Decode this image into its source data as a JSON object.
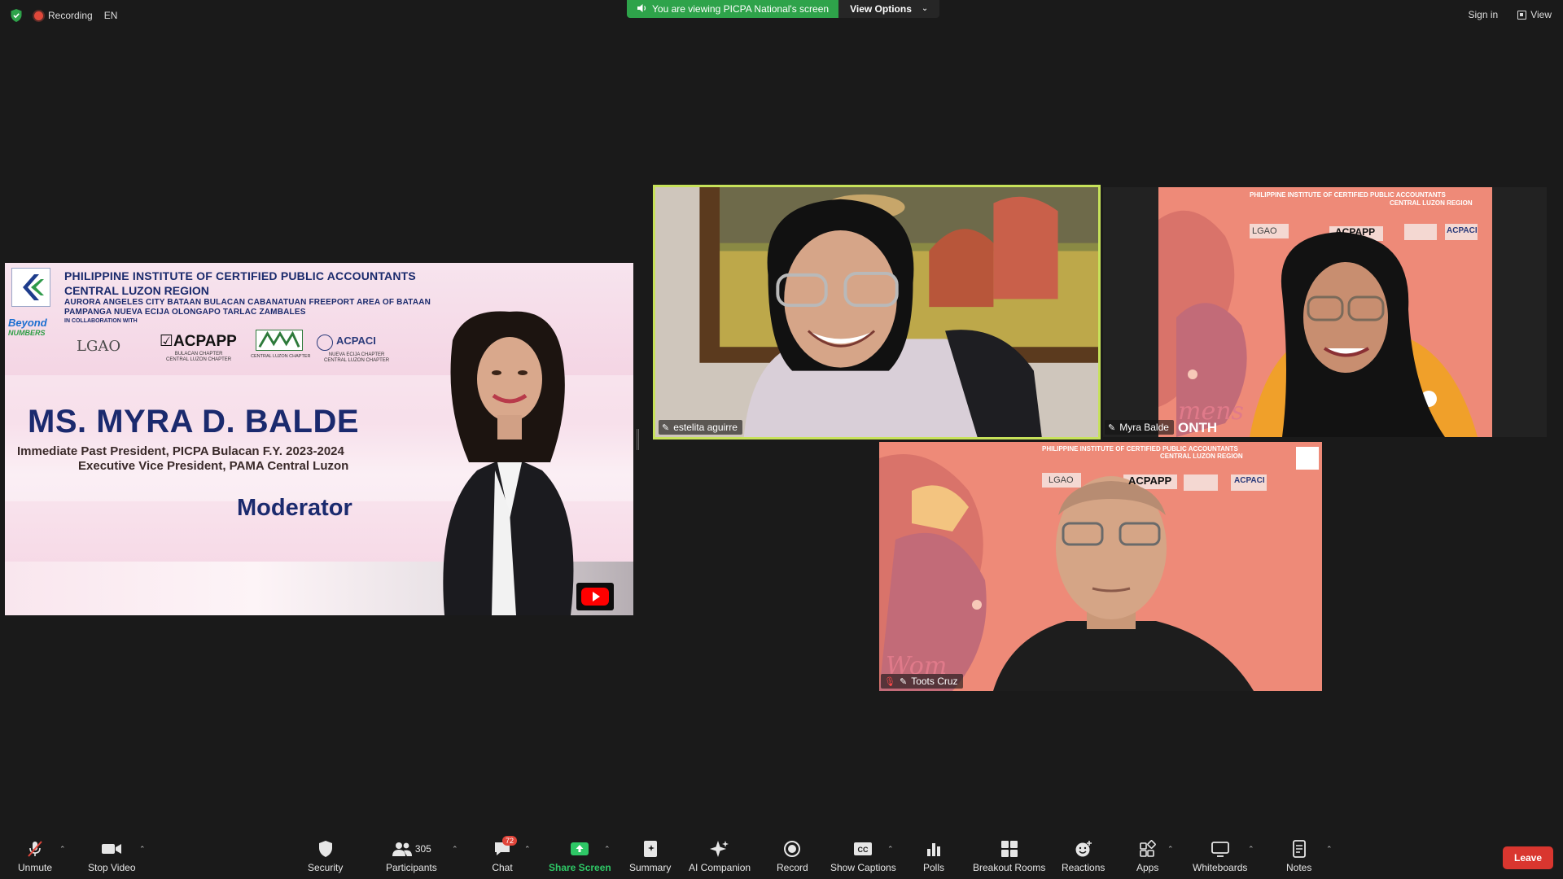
{
  "topbar": {
    "recording_label": "Recording",
    "language": "EN",
    "viewing_banner": "You are viewing PICPA National's screen",
    "view_options_label": "View Options",
    "sign_in_label": "Sign in",
    "view_label": "View"
  },
  "slide": {
    "org_line1": "PHILIPPINE INSTITUTE OF CERTIFIED PUBLIC ACCOUNTANTS",
    "org_line2": "CENTRAL LUZON REGION",
    "chapters_line1": "AURORA  ANGELES CITY  BATAAN  BULACAN  CABANATUAN  FREEPORT AREA OF BATAAN",
    "chapters_line2": "PAMPANGA  NUEVA ECIJA  OLONGAPO  TARLAC  ZAMBALES",
    "collab": "IN COLLABORATION WITH",
    "beyond_1": "Beyond",
    "beyond_2": "NUMBERS",
    "lgao": "LGAO",
    "acpapp": "ACPAPP",
    "acpapp_sub1": "BULACAN CHAPTER",
    "acpapp_sub2": "CENTRAL LUZON CHAPTER",
    "pama_sub": "CENTRAL LUZON CHAPTER",
    "acpaci": "ACPACI",
    "acpaci_sub1": "NUEVA ECIJA CHAPTER",
    "acpaci_sub2": "CENTRAL LUZON CHAPTER",
    "speaker_name": "MS. MYRA D. BALDE",
    "role_1": "Immediate Past President, PICPA Bulacan F.Y. 2023-2024",
    "role_2": "Executive Vice President, PAMA Central Luzon",
    "role_label": "Moderator"
  },
  "participants": {
    "estelita": "estelita aguirre",
    "myra": "Myra Balde",
    "toots": "Toots Cruz"
  },
  "background_text": {
    "womens_month": "mens",
    "month": "ONTH",
    "wom": "Wom",
    "bg_title": "PHILIPPINE INSTITUTE OF CERTIFIED PUBLIC ACCOUNTANTS",
    "bg_sub": "CENTRAL LUZON REGION",
    "bg_acpapp": "ACPAPP",
    "bg_acpaci": "ACPACI",
    "bg_lgao": "LGAO"
  },
  "toolbar": {
    "unmute": "Unmute",
    "stop_video": "Stop Video",
    "security": "Security",
    "participants": "Participants",
    "participants_count": "305",
    "chat": "Chat",
    "chat_badge": "72",
    "share_screen": "Share Screen",
    "summary": "Summary",
    "ai_companion": "AI Companion",
    "record": "Record",
    "show_captions": "Show Captions",
    "polls": "Polls",
    "breakout_rooms": "Breakout Rooms",
    "reactions": "Reactions",
    "apps": "Apps",
    "whiteboards": "Whiteboards",
    "notes": "Notes",
    "leave": "Leave"
  },
  "colors": {
    "share_green": "#2ea34a",
    "active_speaker_border": "#c7e25a",
    "leave_red": "#d9362f",
    "slide_navy": "#1b2a6e"
  }
}
